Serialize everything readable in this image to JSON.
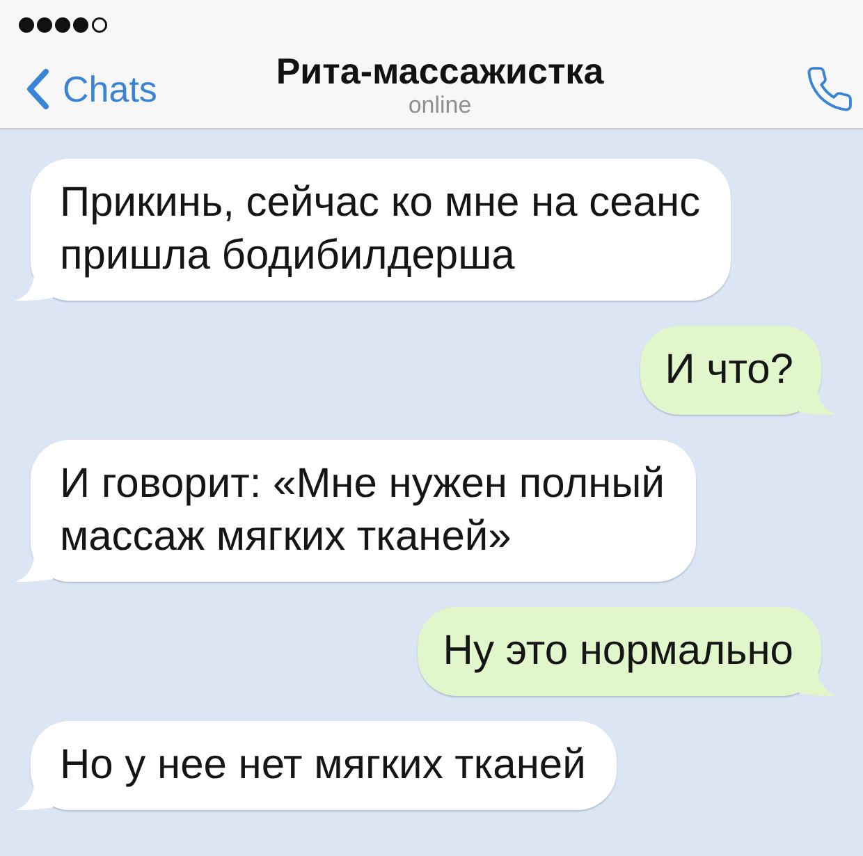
{
  "header": {
    "back_label": "Chats",
    "title": "Рита-массажистка",
    "status": "online"
  },
  "messages": [
    {
      "kind": "incoming",
      "text": "Прикинь, сейчас ко мне на сеанс\nпришла бодибилдерша"
    },
    {
      "kind": "outgoing",
      "text": "И что?"
    },
    {
      "kind": "incoming",
      "text": "И говорит: «Мне нужен полный\nмассаж мягких тканей»"
    },
    {
      "kind": "outgoing",
      "text": "Ну это нормально"
    },
    {
      "kind": "incoming",
      "text": "Но у нее нет мягких тканей"
    }
  ]
}
